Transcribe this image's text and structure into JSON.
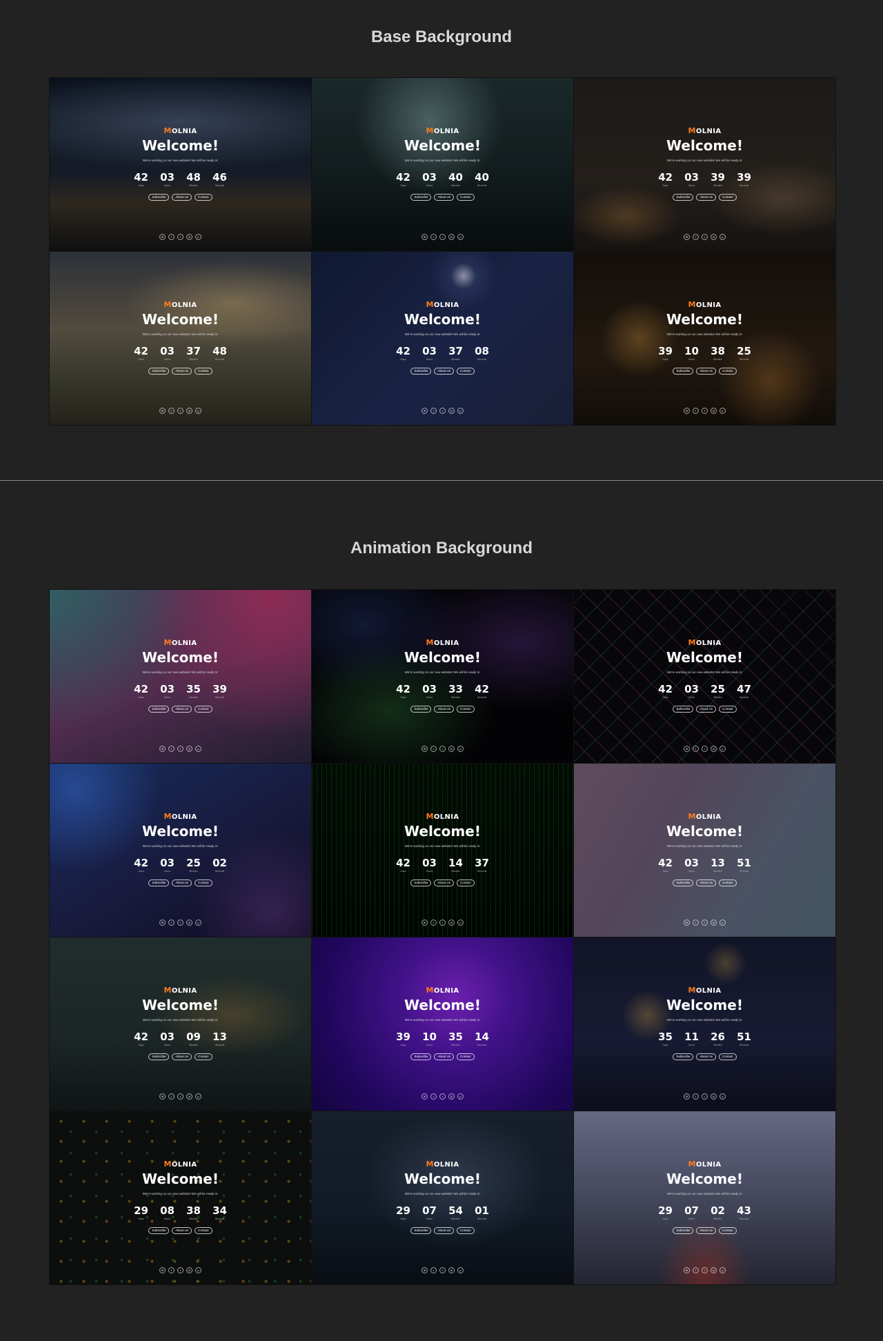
{
  "sections": {
    "base_title": "Base Background",
    "animation_title": "Animation Background"
  },
  "card_text": {
    "logo_mark": "M",
    "logo_text": "OLNIA",
    "welcome": "Welcome!",
    "subtitle": "We're working on our new website! We will be ready in:",
    "unit_labels": [
      "Days",
      "Hours",
      "Minutes",
      "Seconds"
    ],
    "buttons": [
      "Subscribe",
      "About Us",
      "Contact"
    ],
    "social_icons": [
      "mail-icon",
      "facebook-icon",
      "twitter-icon",
      "instagram-icon",
      "pinterest-icon"
    ]
  },
  "base_cards": [
    {
      "timer": [
        "42",
        "03",
        "48",
        "46"
      ]
    },
    {
      "timer": [
        "42",
        "03",
        "40",
        "40"
      ]
    },
    {
      "timer": [
        "42",
        "03",
        "39",
        "39"
      ]
    },
    {
      "timer": [
        "42",
        "03",
        "37",
        "48"
      ]
    },
    {
      "timer": [
        "42",
        "03",
        "37",
        "08"
      ]
    },
    {
      "timer": [
        "39",
        "10",
        "38",
        "25"
      ]
    }
  ],
  "animation_cards": [
    {
      "timer": [
        "42",
        "03",
        "35",
        "39"
      ]
    },
    {
      "timer": [
        "42",
        "03",
        "33",
        "42"
      ]
    },
    {
      "timer": [
        "42",
        "03",
        "25",
        "47"
      ]
    },
    {
      "timer": [
        "42",
        "03",
        "25",
        "02"
      ]
    },
    {
      "timer": [
        "42",
        "03",
        "14",
        "37"
      ]
    },
    {
      "timer": [
        "42",
        "03",
        "13",
        "51"
      ]
    },
    {
      "timer": [
        "42",
        "03",
        "09",
        "13"
      ]
    },
    {
      "timer": [
        "39",
        "10",
        "35",
        "14"
      ]
    },
    {
      "timer": [
        "35",
        "11",
        "26",
        "51"
      ]
    },
    {
      "timer": [
        "29",
        "08",
        "38",
        "34"
      ]
    },
    {
      "timer": [
        "29",
        "07",
        "54",
        "01"
      ]
    },
    {
      "timer": [
        "29",
        "07",
        "02",
        "43"
      ]
    }
  ]
}
